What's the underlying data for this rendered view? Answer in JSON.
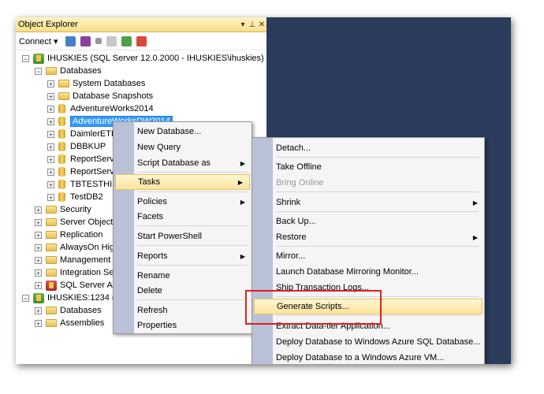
{
  "object_explorer": {
    "title": "Object Explorer",
    "controls": [
      "▾",
      "⊥",
      "✕"
    ],
    "toolbar": {
      "connect_label": "Connect ▾"
    },
    "tree": [
      {
        "label": "IHUSKIES (SQL Server 12.0.2000 - IHUSKIES\\ihuskies)",
        "icon": "server"
      },
      {
        "label": "Databases",
        "icon": "folder"
      },
      {
        "label": "System Databases",
        "icon": "folder"
      },
      {
        "label": "Database Snapshots",
        "icon": "folder"
      },
      {
        "label": "AdventureWorks2014",
        "icon": "database"
      },
      {
        "label": "AdventureWorksDW2014",
        "icon": "database"
      },
      {
        "label": "DaimlerETL",
        "icon": "database"
      },
      {
        "label": "DBBKUP",
        "icon": "database"
      },
      {
        "label": "ReportServer",
        "icon": "database"
      },
      {
        "label": "ReportServer",
        "icon": "database"
      },
      {
        "label": "TBTESTHIS",
        "icon": "database"
      },
      {
        "label": "TestDB2",
        "icon": "database"
      },
      {
        "label": "Security",
        "icon": "folder"
      },
      {
        "label": "Server Objects",
        "icon": "folder"
      },
      {
        "label": "Replication",
        "icon": "folder"
      },
      {
        "label": "AlwaysOn High",
        "icon": "folder"
      },
      {
        "label": "Management",
        "icon": "folder"
      },
      {
        "label": "Integration Ser",
        "icon": "folder"
      },
      {
        "label": "SQL Server Age",
        "icon": "agent"
      },
      {
        "label": "IHUSKIES:1234 (Mi",
        "icon": "server"
      },
      {
        "label": "Databases",
        "icon": "folder"
      },
      {
        "label": "Assemblies",
        "icon": "folder"
      }
    ]
  },
  "context_menu": {
    "items": [
      {
        "label": "New Database..."
      },
      {
        "label": "New Query"
      },
      {
        "label": "Script Database as",
        "submenu": true
      },
      {
        "label": "Tasks",
        "submenu": true,
        "selected": true
      },
      {
        "label": "Policies",
        "submenu": true
      },
      {
        "label": "Facets"
      },
      {
        "label": "Start PowerShell"
      },
      {
        "label": "Reports",
        "submenu": true
      },
      {
        "label": "Rename"
      },
      {
        "label": "Delete"
      },
      {
        "label": "Refresh"
      },
      {
        "label": "Properties"
      }
    ]
  },
  "tasks_menu": {
    "items": [
      {
        "label": "Detach..."
      },
      {
        "label": "Take Offline"
      },
      {
        "label": "Bring Online",
        "disabled": true
      },
      {
        "label": "Shrink",
        "submenu": true
      },
      {
        "label": "Back Up..."
      },
      {
        "label": "Restore",
        "submenu": true
      },
      {
        "label": "Mirror..."
      },
      {
        "label": "Launch Database Mirroring Monitor..."
      },
      {
        "label": "Ship Transaction Logs..."
      },
      {
        "label": "Generate Scripts...",
        "highlighted": true
      },
      {
        "label": "Extract Data-tier Application..."
      },
      {
        "label": "Deploy Database to Windows Azure SQL Database..."
      },
      {
        "label": "Deploy Database to a Windows Azure VM..."
      }
    ]
  },
  "colors": {
    "background_panel": "#2b3b5b",
    "selection": "#3399ff",
    "menu_gutter": "#b9c1d7",
    "highlight": "#fbe3a0",
    "annotation_box": "#e02020"
  }
}
